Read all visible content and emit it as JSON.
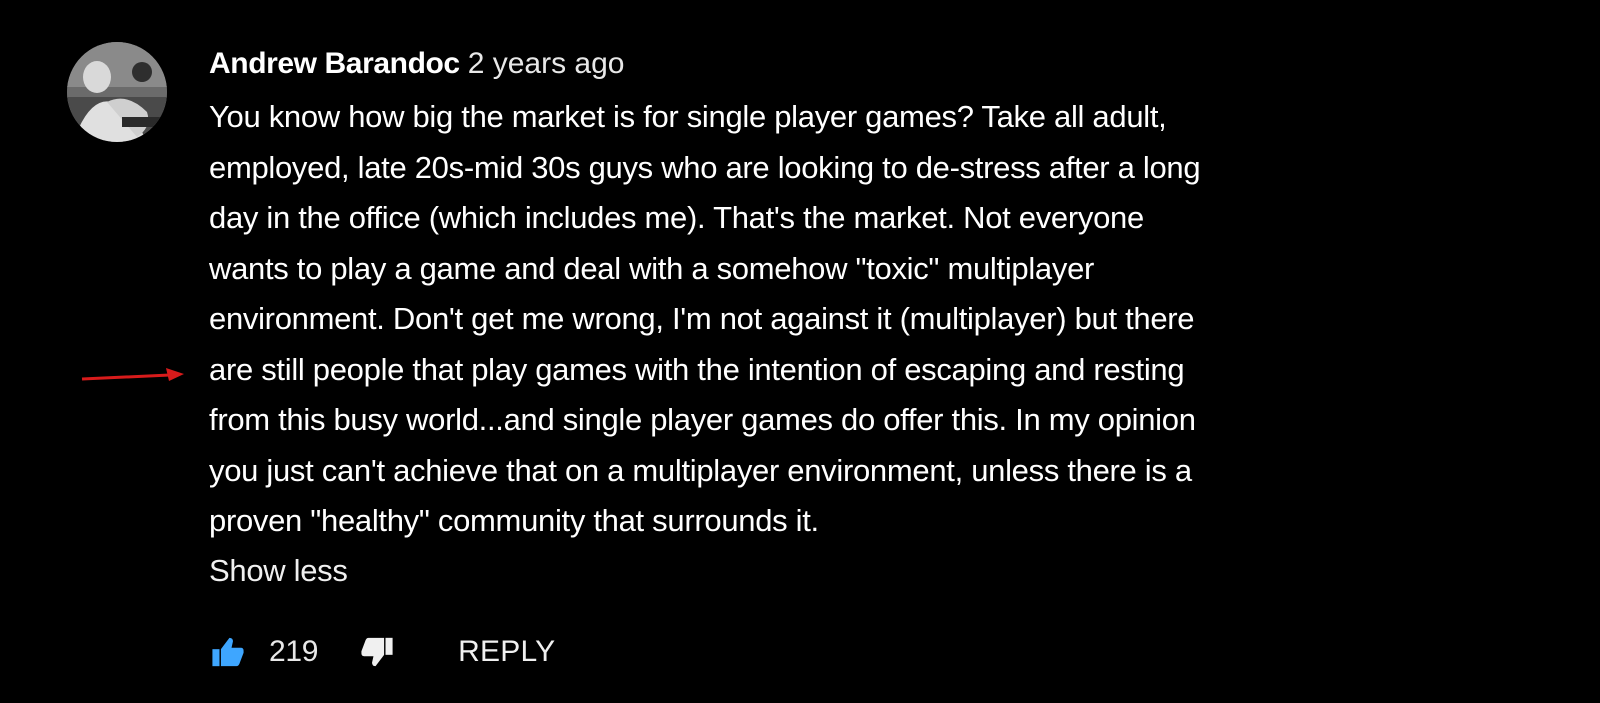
{
  "comment": {
    "author": "Andrew Barandoc",
    "timestamp": "2 years ago",
    "text_lines": [
      "You know how big the market is for single player games? Take all adult,",
      "employed, late 20s-mid 30s guys who are looking to de-stress after a long",
      "day in the office (which includes me). That's the market. Not everyone",
      "wants to play a game and deal with a somehow \"toxic\" multiplayer",
      "environment. Don't get me wrong, I'm not against it (multiplayer) but there",
      "are still people that play games with the intention of  escaping and resting",
      "from this busy world...and single player games do offer this. In my opinion",
      "you just can't achieve that on a multiplayer environment, unless there is a",
      "proven \"healthy\" community that surrounds it."
    ],
    "show_less_label": "Show less",
    "like_count": "219",
    "reply_label": "REPLY"
  },
  "icons": {
    "like": "thumbs-up-icon",
    "dislike": "thumbs-down-icon",
    "annotation": "red-arrow-icon"
  },
  "colors": {
    "background": "#000000",
    "text": "#ffffff",
    "like_active": "#3ea6ff",
    "annotation_arrow": "#d81b1b"
  }
}
